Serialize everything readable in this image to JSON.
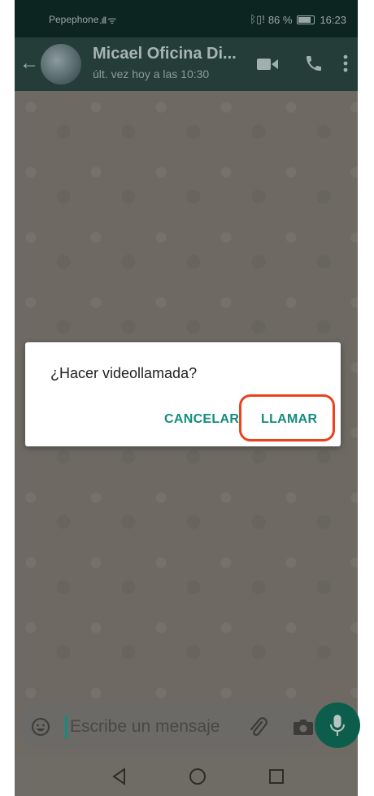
{
  "status_bar": {
    "carrier": "Pepephone",
    "signal": ".ıll",
    "wifi": "ᯤ",
    "status_icons": "ᛒ▯!",
    "battery": "86 %",
    "time": "16:23"
  },
  "header": {
    "contact_name": "Micael Oficina Di...",
    "last_seen": "últ. vez hoy a las 10:30"
  },
  "dialog": {
    "title": "¿Hacer videollamada?",
    "cancel_label": "CANCELAR",
    "call_label": "LLAMAR"
  },
  "input": {
    "placeholder": "Escribe un mensaje"
  },
  "colors": {
    "accent": "#128C7E",
    "highlight": "#e8431d",
    "header": "#243d39"
  }
}
